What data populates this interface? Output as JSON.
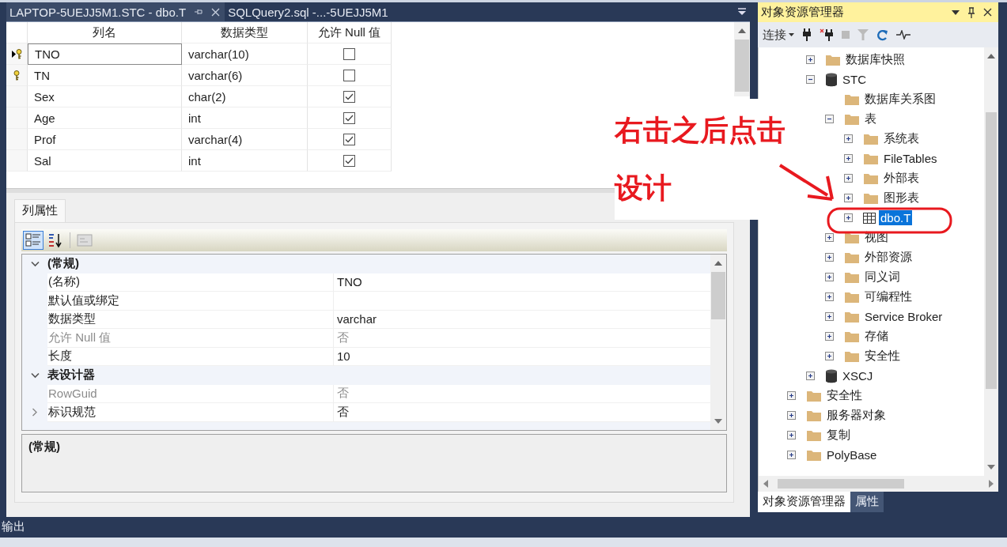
{
  "doc_tabs": [
    {
      "title": "LAPTOP-5UEJJ5M1.STC - dbo.T",
      "selected": true
    },
    {
      "title": "SQLQuery2.sql -...-5UEJJ5M1",
      "selected": false
    }
  ],
  "table_design": {
    "columns": [
      "列名",
      "数据类型",
      "允许 Null 值"
    ],
    "rows": [
      {
        "name": "TNO",
        "type": "varchar(10)",
        "allow_null": false,
        "primary_key": true,
        "current": true
      },
      {
        "name": "TN",
        "type": "varchar(6)",
        "allow_null": false,
        "primary_key": true,
        "current": false
      },
      {
        "name": "Sex",
        "type": "char(2)",
        "allow_null": true,
        "primary_key": false,
        "current": false
      },
      {
        "name": "Age",
        "type": "int",
        "allow_null": true,
        "primary_key": false,
        "current": false
      },
      {
        "name": "Prof",
        "type": "varchar(4)",
        "allow_null": true,
        "primary_key": false,
        "current": false
      },
      {
        "name": "Sal",
        "type": "int",
        "allow_null": true,
        "primary_key": false,
        "current": false
      }
    ]
  },
  "properties_tab": "列属性",
  "property_grid": {
    "categories": [
      {
        "name": "(常规)",
        "expanded": true,
        "rows": [
          {
            "name": "(名称)",
            "value": "TNO",
            "disabled": false
          },
          {
            "name": "默认值或绑定",
            "disabled": false
          },
          {
            "name": "数据类型",
            "value": "varchar",
            "disabled": false
          },
          {
            "name": "允许 Null 值",
            "value": "否",
            "disabled": true
          },
          {
            "name": "长度",
            "value": "10",
            "disabled": false
          }
        ]
      },
      {
        "name": "表设计器",
        "expanded": true,
        "rows": [
          {
            "name": "RowGuid",
            "value": "否",
            "disabled": true
          },
          {
            "name": "标识规范",
            "value": "否",
            "disabled": false,
            "expanded": false
          }
        ]
      }
    ],
    "description": "(常规)"
  },
  "output_bar": "输出",
  "object_explorer": {
    "title": "对象资源管理器",
    "connect": "连接",
    "tree": [
      {
        "children": [
          {
            "label": "数据库快照",
            "kind": "folder",
            "expanded": false,
            "selected": false
          },
          {
            "label": "STC",
            "kind": "database",
            "expanded": true,
            "selected": false,
            "children": [
              {
                "label": "数据库关系图",
                "kind": "folder",
                "selected": false
              },
              {
                "label": "表",
                "kind": "folder",
                "expanded": true,
                "selected": false,
                "children": [
                  {
                    "label": "系统表",
                    "kind": "folder",
                    "expanded": false,
                    "selected": false
                  },
                  {
                    "label": "FileTables",
                    "kind": "folder",
                    "expanded": false,
                    "selected": false
                  },
                  {
                    "label": "外部表",
                    "kind": "folder",
                    "expanded": false,
                    "selected": false
                  },
                  {
                    "label": "图形表",
                    "kind": "folder",
                    "expanded": false,
                    "selected": false
                  },
                  {
                    "label": "dbo.T",
                    "kind": "table",
                    "expanded": false,
                    "selected": true
                  }
                ]
              },
              {
                "label": "视图",
                "kind": "folder",
                "expanded": false,
                "selected": false
              },
              {
                "label": "外部资源",
                "kind": "folder",
                "expanded": false,
                "selected": false
              },
              {
                "label": "同义词",
                "kind": "folder",
                "expanded": false,
                "selected": false
              },
              {
                "label": "可编程性",
                "kind": "folder",
                "expanded": false,
                "selected": false
              },
              {
                "label": "Service Broker",
                "kind": "folder",
                "expanded": false,
                "selected": false
              },
              {
                "label": "存储",
                "kind": "folder",
                "expanded": false,
                "selected": false
              },
              {
                "label": "安全性",
                "kind": "folder",
                "expanded": false,
                "selected": false
              }
            ]
          },
          {
            "label": "XSCJ",
            "kind": "database",
            "expanded": false,
            "selected": false
          }
        ]
      },
      {
        "label": "安全性",
        "kind": "folder",
        "expanded": false,
        "selected": false
      },
      {
        "label": "服务器对象",
        "kind": "folder",
        "expanded": false,
        "selected": false
      },
      {
        "label": "复制",
        "kind": "folder",
        "expanded": false,
        "selected": false
      },
      {
        "label": "PolyBase",
        "kind": "folder",
        "expanded": false,
        "selected": false
      }
    ]
  },
  "bottom_tabs": [
    {
      "label": "对象资源管理器",
      "selected": true
    },
    {
      "label": "属性",
      "selected": false
    }
  ],
  "annotation": {
    "lines": [
      "右击之后点击",
      "设计"
    ]
  }
}
